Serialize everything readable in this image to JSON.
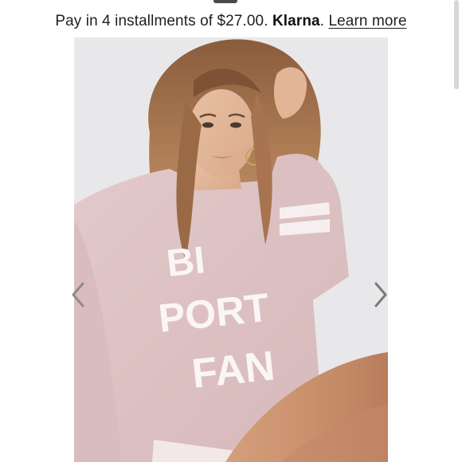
{
  "payment_banner": {
    "prefix": "Pay in 4 installments of $27.00. ",
    "brand": "Klarna",
    "separator": ". ",
    "link_label": "Learn more"
  },
  "carousel": {
    "prev_icon": "chevron-left-icon",
    "next_icon": "chevron-right-icon",
    "photo_subject": "product-photo",
    "sweatshirt_print_lines": [
      "BI",
      "PORT",
      "FAN"
    ]
  },
  "colors": {
    "text": "#1f1f1f",
    "sweatshirt": "#dfc3c4",
    "background": "#ffffff",
    "photo_backdrop": "#e8e8ea"
  }
}
